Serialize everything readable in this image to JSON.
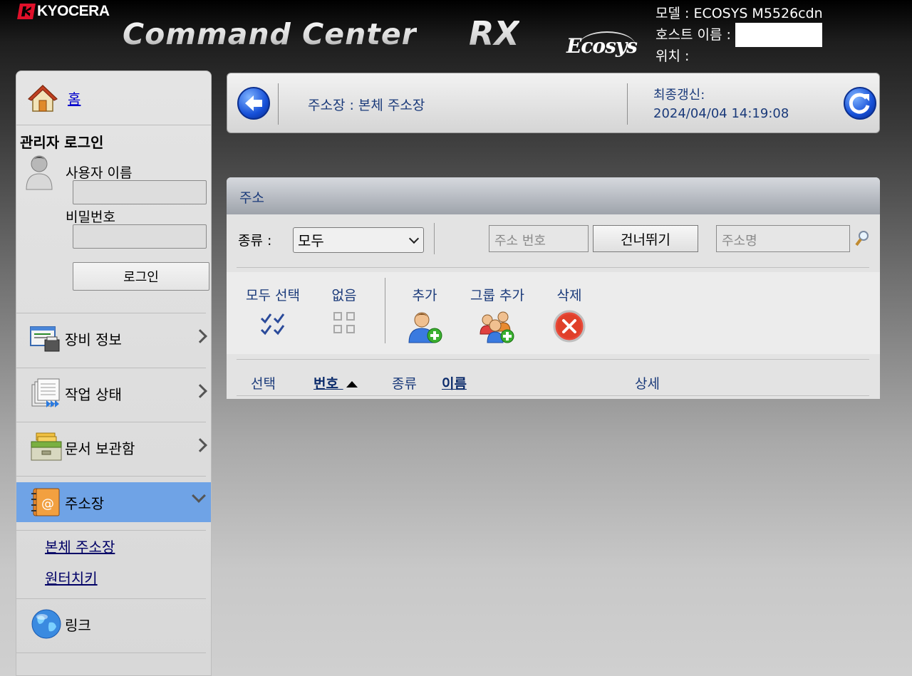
{
  "header": {
    "brand": "KYOCERA",
    "title_main": "Command Center",
    "title_rx": "RX",
    "title_ecosys": "Ecosys",
    "model_label": "모델 : ECOSYS M5526cdn",
    "host_label": "호스트 이름 :",
    "location_label": "위치 :"
  },
  "sidebar": {
    "home_label": "홈",
    "login_title": "관리자 로그인",
    "username_label": "사용자 이름",
    "password_label": "비밀번호",
    "username_value": "",
    "password_value": "",
    "login_button": "로그인",
    "nav": [
      {
        "label": "장비 정보"
      },
      {
        "label": "작업 상태"
      },
      {
        "label": "문서 보관함"
      },
      {
        "label": "주소장"
      },
      {
        "label": "링크"
      }
    ],
    "subnav": [
      {
        "label": "본체 주소장"
      },
      {
        "label": "원터치키"
      }
    ]
  },
  "top_panel": {
    "breadcrumb": "주소장 : 본체 주소장",
    "last_updated_label": "최종갱신:",
    "last_updated_value": "2024/04/04 14:19:08"
  },
  "main": {
    "title": "주소",
    "type_label": "종류 :",
    "type_selected": "모두",
    "address_number_placeholder": "주소 번호",
    "skip_button": "건너뛰기",
    "address_name_placeholder": "주소명",
    "actions": {
      "select_all": "모두 선택",
      "none": "없음",
      "add": "추가",
      "add_group": "그룹 추가",
      "delete": "삭제"
    },
    "columns": {
      "select": "선택",
      "number": "번호",
      "type": "종류",
      "name": "이름",
      "detail": "상세"
    }
  },
  "colors": {
    "active_nav": "#6fa3e6",
    "link": "#0000cc",
    "panel_text": "#1a3a7a"
  }
}
